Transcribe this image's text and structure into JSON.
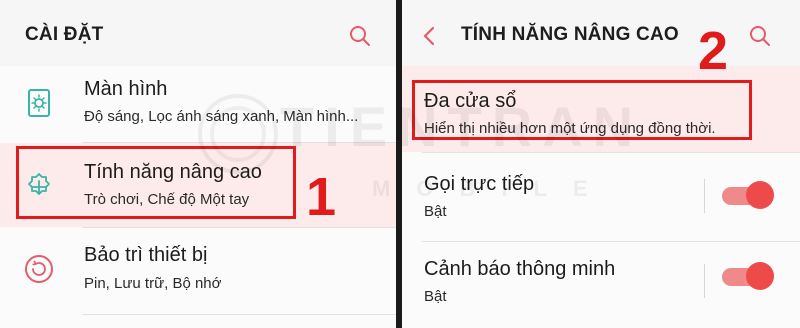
{
  "left_panel": {
    "title": "CÀI ĐẶT",
    "items": [
      {
        "title": "Màn hình",
        "subtitle": "Độ sáng, Lọc ánh sáng xanh, Màn hình...",
        "icon": "display-settings-icon"
      },
      {
        "title": "Tính năng nâng cao",
        "subtitle": "Trò chơi, Chế độ Một tay",
        "icon": "advanced-features-gear-icon"
      },
      {
        "title": "Bảo trì thiết bị",
        "subtitle": "Pin, Lưu trữ, Bộ nhớ",
        "icon": "device-maintenance-icon"
      }
    ],
    "step_label": "1"
  },
  "right_panel": {
    "title": "TÍNH NĂNG NÂNG CAO",
    "items": [
      {
        "title": "Đa cửa sổ",
        "subtitle": "Hiển thị nhiều hơn một ứng dụng đồng thời."
      },
      {
        "title": "Gọi trực tiếp",
        "subtitle": "Bật",
        "toggle_on": true
      },
      {
        "title": "Cảnh báo thông minh",
        "subtitle": "Bật",
        "toggle_on": true
      }
    ],
    "step_label": "2"
  },
  "colors": {
    "accent_red": "#e01b1b",
    "icon_teal": "#3bb3a8",
    "icon_pink": "#e35c6a",
    "toggle_thumb": "#ee4a4a",
    "toggle_track": "#f08a8a"
  },
  "watermark": {
    "line1": "TIENTRAN",
    "line2": "MOBILE"
  }
}
